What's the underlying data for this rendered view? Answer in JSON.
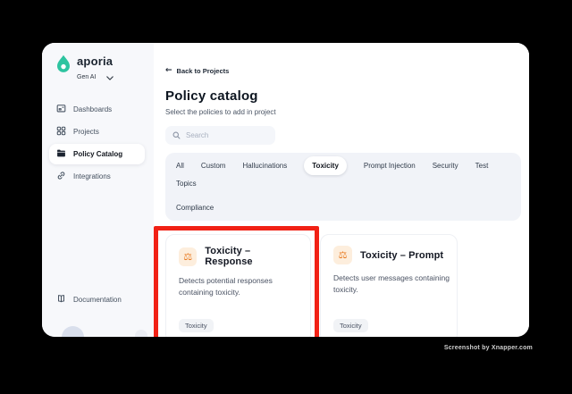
{
  "window": {
    "brand": {
      "name": "aporia",
      "workspace": "Gen AI"
    },
    "sidebar": {
      "items": [
        {
          "label": "Dashboards",
          "icon": "dashboard-icon"
        },
        {
          "label": "Projects",
          "icon": "projects-grid-icon"
        },
        {
          "label": "Policy Catalog",
          "icon": "folder-icon"
        },
        {
          "label": "Integrations",
          "icon": "link-icon"
        }
      ],
      "documentation": {
        "label": "Documentation",
        "icon": "book-icon"
      }
    },
    "main": {
      "back_link": {
        "label": "Back to Projects"
      },
      "title": "Policy catalog",
      "subtitle": "Select the policies to add in project",
      "search": {
        "placeholder": "Search"
      },
      "tabs": [
        "All",
        "Custom",
        "Hallucinations",
        "Toxicity",
        "Prompt Injection",
        "Security",
        "Test",
        "Topics",
        "Compliance"
      ],
      "active_tab": "Toxicity",
      "cards": [
        {
          "title": "Toxicity – Response",
          "description": "Detects potential responses containing toxicity.",
          "tag": "Toxicity",
          "icon": "scales-icon",
          "icon_glyph": "⚖",
          "highlighted": true
        },
        {
          "title": "Toxicity – Prompt",
          "description": "Detects user messages containing toxicity.",
          "tag": "Toxicity",
          "icon": "scales-icon",
          "icon_glyph": "⚖",
          "highlighted": false
        }
      ]
    }
  },
  "watermark": "Screenshot by Xnapper.com",
  "colors": {
    "brand_teal": "#2ec4a0",
    "highlight_red": "#f12115",
    "card_icon_orange": "#e8791f",
    "card_icon_bg": "#fdeedd",
    "sidebar_bg": "#f7f8fb",
    "tabs_bg": "#f1f3f8"
  }
}
